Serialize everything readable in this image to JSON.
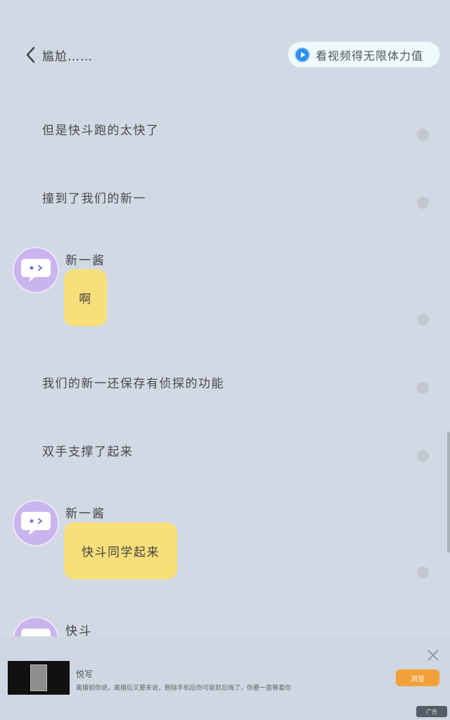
{
  "header": {
    "title": "尴尬……",
    "reward_label": "看视频得无限体力值"
  },
  "story": {
    "narration": [
      "但是快斗跑的太快了",
      "撞到了我们的新一",
      "我们的新一还保存有侦探的功能",
      "双手支撑了起来"
    ],
    "messages": [
      {
        "speaker": "新一酱",
        "text": "啊"
      },
      {
        "speaker": "新一酱",
        "text": "快斗同学起来"
      },
      {
        "speaker": "快斗",
        "text": ""
      }
    ]
  },
  "ad": {
    "title": "悦写",
    "description": "离婚前你说，离婚后又要来说，删除手机后你可能就后悔了，你要一直等着你",
    "button_label": "浏览",
    "badge": "广告"
  },
  "colors": {
    "background": "#d1d9e4",
    "bubble": "#f7df7a",
    "avatar": "#c9b4ee",
    "reward_pill": "#eef9fb",
    "play_icon": "#2f8ff0",
    "ad_button": "#f2a13a"
  },
  "icons": {
    "back": "chevron-left-icon",
    "reward": "play-circle-icon",
    "avatar": "chat-bubble-face-icon",
    "ad_close": "close-icon"
  }
}
